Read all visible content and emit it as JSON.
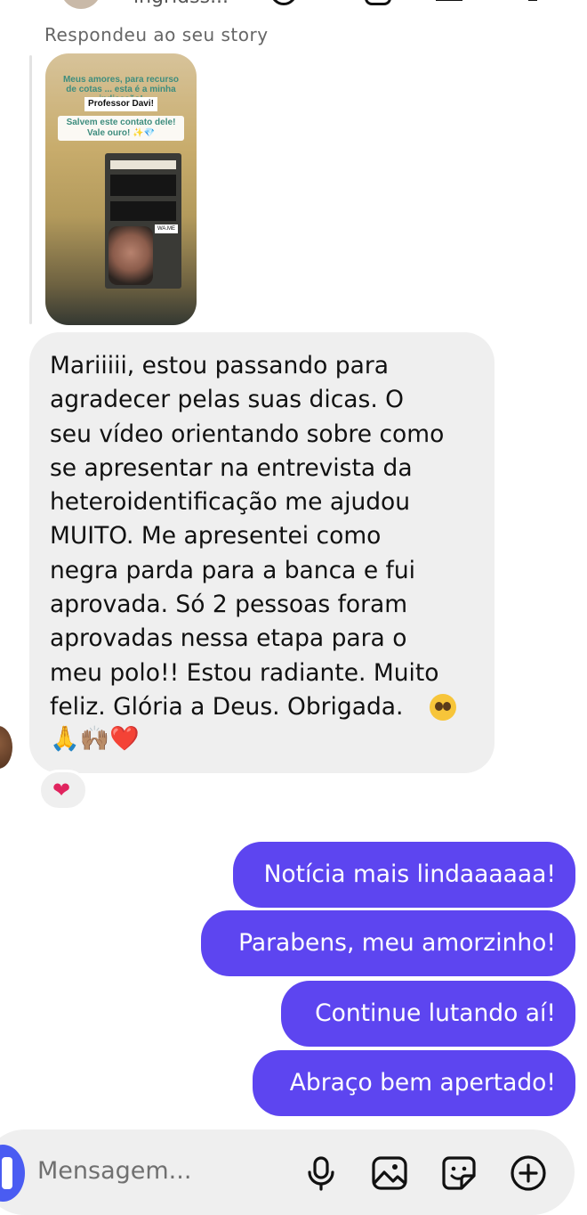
{
  "header": {
    "contact_name": "ingridss..."
  },
  "story_reply": {
    "label": "Respondeu ao seu story",
    "story": {
      "headline": "Meus amores, para recurso de cotas ... esta é a minha indicação!",
      "name_tag": "Professor Davi!",
      "cta": "Salvem este contato dele! Vale ouro! ✨💎",
      "inner_tag": "WA.ME"
    }
  },
  "incoming": {
    "text": "Mariiiii, estou passando para\nagradecer pelas suas dicas. O\nseu vídeo orientando sobre como\nse apresentar na entrevista da\nheteroidentificação me ajudou\nMUITO. Me apresentei como\nnegra parda para a banca e fui\naprovada. Só 2 pessoas foram\naprovadas nessa etapa para o\nmeu polo!! Estou radiante. Muito\nfeliz. Glória a Deus. Obrigada.",
    "emoji_line": "🙏🙌🏽❤️",
    "reaction": "❤"
  },
  "outgoing": [
    {
      "text": "Notícia mais lindaaaaaa!"
    },
    {
      "text": "Parabens, meu amorzinho!"
    },
    {
      "text": "Continue lutando aí!"
    },
    {
      "text": "Abraço bem apertado!"
    }
  ],
  "composer": {
    "placeholder": "Mensagem...",
    "icons": [
      "camera-icon",
      "microphone-icon",
      "image-icon",
      "sticker-icon",
      "plus-icon"
    ]
  },
  "colors": {
    "outgoing_bubble": "#5d45f0",
    "incoming_bubble": "#efefef",
    "composer_bg": "#efefef",
    "reaction_heart": "#e0245e"
  }
}
